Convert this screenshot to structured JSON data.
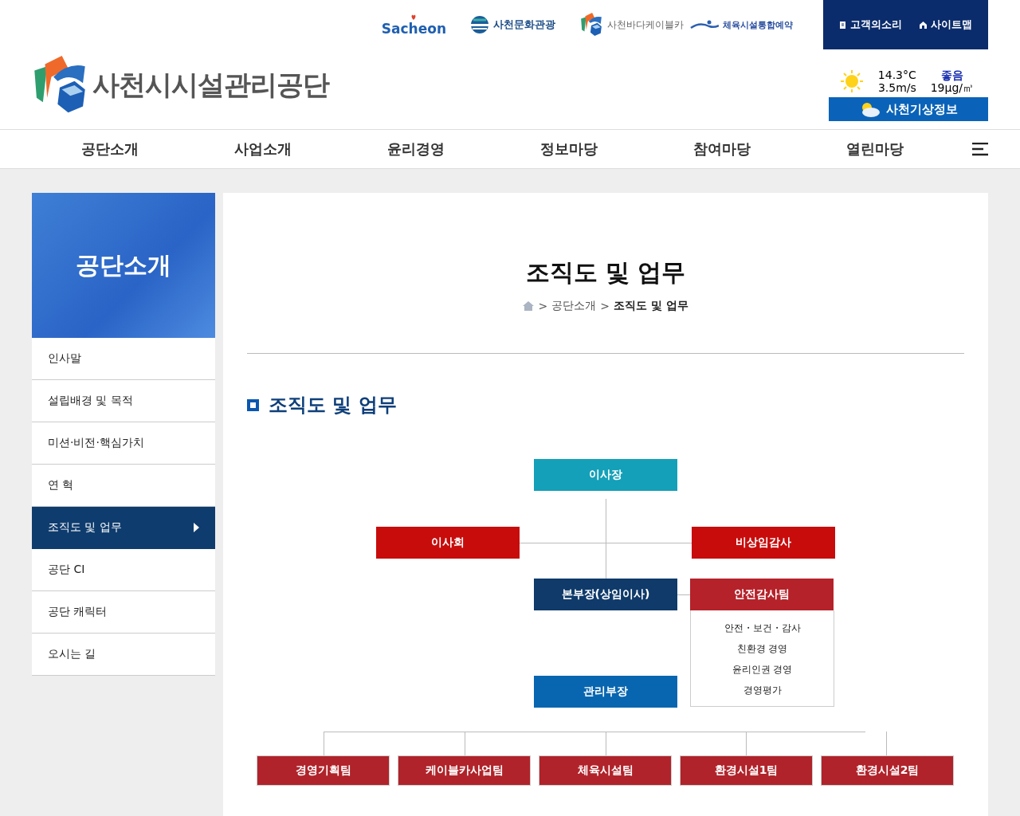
{
  "top_bar": {
    "partners": [
      {
        "kind": "sacheon",
        "label": "Sacheon"
      },
      {
        "kind": "culture",
        "label": "사천문화관광"
      },
      {
        "kind": "cablecar",
        "label": "사천바다케이블카"
      },
      {
        "kind": "sports",
        "label": "체육시설통합예약"
      }
    ],
    "utility_links": [
      {
        "kind": "voice",
        "label": "고객의소리"
      },
      {
        "kind": "sitemap",
        "label": "사이트맵"
      }
    ]
  },
  "logo": {
    "title": "사천시시설관리공단"
  },
  "weather": {
    "temperature": "14.3°C",
    "wind": "3.5m/s",
    "air_quality": "좋음",
    "dust": "19μg/㎥",
    "button": "사천기상정보"
  },
  "nav": {
    "items": [
      "공단소개",
      "사업소개",
      "윤리경영",
      "정보마당",
      "참여마당",
      "열린마당"
    ]
  },
  "sidebar": {
    "title": "공단소개",
    "items": [
      {
        "label": "인사말",
        "selected": false
      },
      {
        "label": "설립배경 및 목적",
        "selected": false
      },
      {
        "label": "미션·비전·핵심가치",
        "selected": false
      },
      {
        "label": "연 혁",
        "selected": false
      },
      {
        "label": "조직도 및 업무",
        "selected": true
      },
      {
        "label": "공단 CI",
        "selected": false
      },
      {
        "label": "공단 캐릭터",
        "selected": false
      },
      {
        "label": "오시는 길",
        "selected": false
      }
    ]
  },
  "page": {
    "title": "조직도 및 업무",
    "breadcrumb": [
      {
        "label": "공단소개",
        "current": false
      },
      {
        "label": "조직도 및 업무",
        "current": true
      }
    ],
    "separator": ">",
    "section_title": "조직도 및 업무"
  },
  "org_chart": {
    "nodes": [
      {
        "label": "이사장",
        "color": "#14a0b8"
      },
      {
        "label": "이사회",
        "color": "#c80c0c"
      },
      {
        "label": "비상임감사",
        "color": "#c80c0c"
      },
      {
        "label": "본부장(상임이사)",
        "color": "#0f3a6a"
      },
      {
        "label": "관리부장",
        "color": "#0866b0"
      },
      {
        "label": "안전감사팀",
        "color": "#b5222a",
        "duties": [
          "안전・보건・감사",
          "친환경 경영",
          "윤리인권 경영",
          "경영평가"
        ]
      }
    ],
    "teams": [
      "경영기획팀",
      "케이블카사업팀",
      "체육시설팀",
      "환경시설1팀",
      "환경시설2팀"
    ]
  }
}
